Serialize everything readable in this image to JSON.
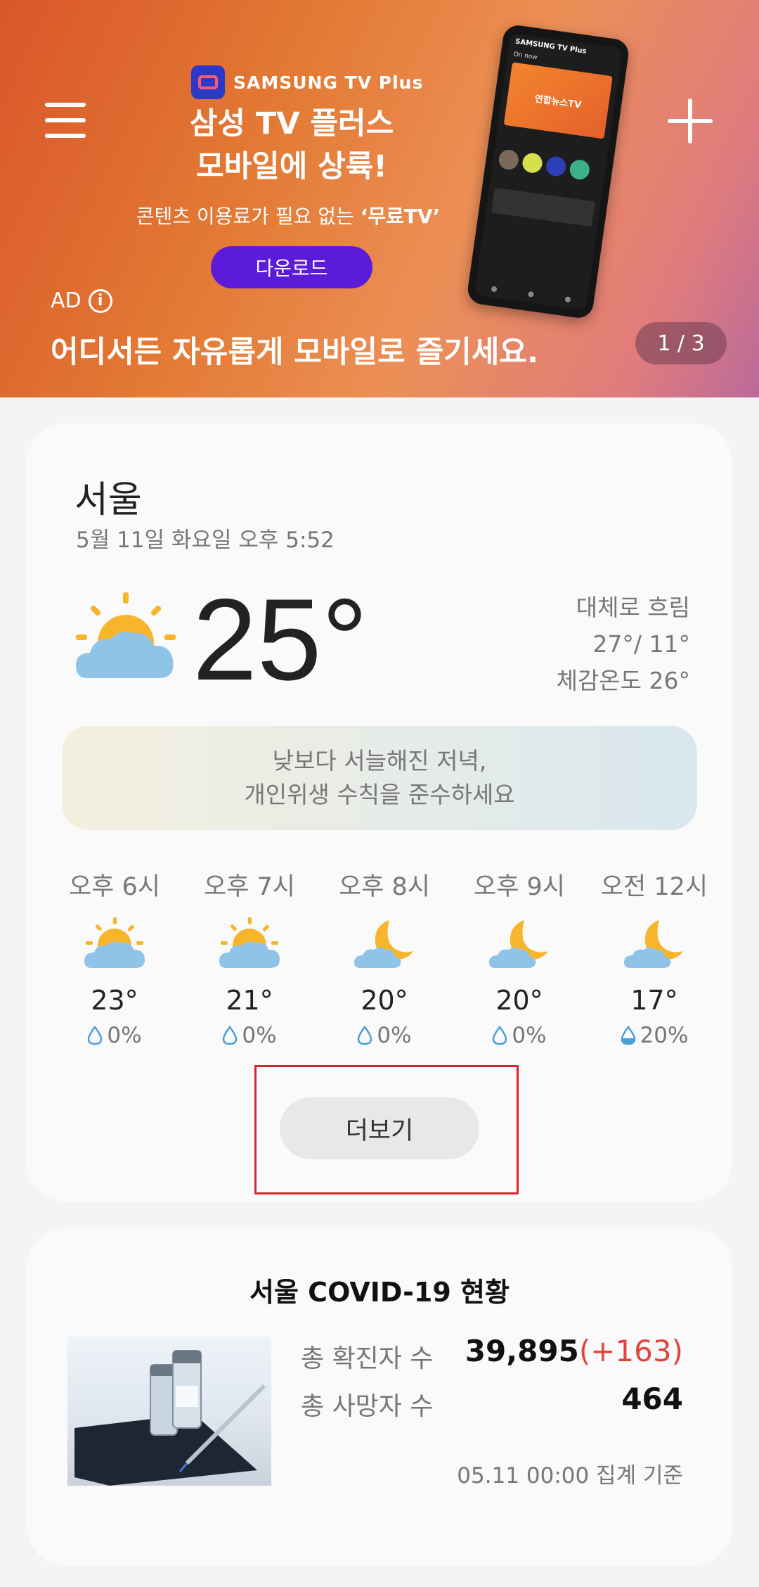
{
  "banner": {
    "brand": "SAMSUNG TV Plus",
    "headline_line1": "삼성 TV 플러스",
    "headline_line2": "모바일에 상륙!",
    "subtitle_prefix": "콘텐츠 이용료가 필요 없는 ",
    "subtitle_emphasis": "‘무료TV’",
    "download_label": "다운로드",
    "ad_label": "AD",
    "caption": "어디서든 자유롭게 모바일로 즐기세요.",
    "page_indicator": "1 / 3",
    "phone": {
      "brand": "SAMSUNG TV Plus",
      "on_now": "On now",
      "hero_text": "연합뉴스TV"
    }
  },
  "weather": {
    "city": "서울",
    "datetime": "5월 11일 화요일 오후 5:52",
    "current_temp": "25°",
    "condition": "대체로 흐림",
    "hi_lo": "27°/ 11°",
    "feels_like": "체감온도 26°",
    "message_line1": "낮보다 서늘해진 저녁,",
    "message_line2": "개인위생 수칙을 준수하세요",
    "hourly": [
      {
        "time": "오후 6시",
        "icon": "sun-cloud-icon",
        "temp": "23°",
        "rain": "0%"
      },
      {
        "time": "오후 7시",
        "icon": "sun-cloud-icon",
        "temp": "21°",
        "rain": "0%"
      },
      {
        "time": "오후 8시",
        "icon": "moon-cloud-icon",
        "temp": "20°",
        "rain": "0%"
      },
      {
        "time": "오후 9시",
        "icon": "moon-cloud-icon",
        "temp": "20°",
        "rain": "0%"
      },
      {
        "time": "오전 12시",
        "icon": "moon-cloud-icon",
        "temp": "17°",
        "rain": "20%"
      }
    ],
    "more_label": "더보기"
  },
  "covid": {
    "title": "서울 COVID-19 현황",
    "total_cases_label": "총 확진자 수",
    "total_cases_value": "39,895",
    "total_cases_delta": "(+163)",
    "total_deaths_label": "총 사망자 수",
    "total_deaths_value": "464",
    "footnote": "05.11 00:00 집계 기준"
  },
  "colors": {
    "accent_purple": "#5b1bd9",
    "delta_red": "#e0453d",
    "highlight_red": "#d8242e",
    "sun_yellow": "#f7b52c",
    "cloud_blue": "#8fc3e8"
  }
}
